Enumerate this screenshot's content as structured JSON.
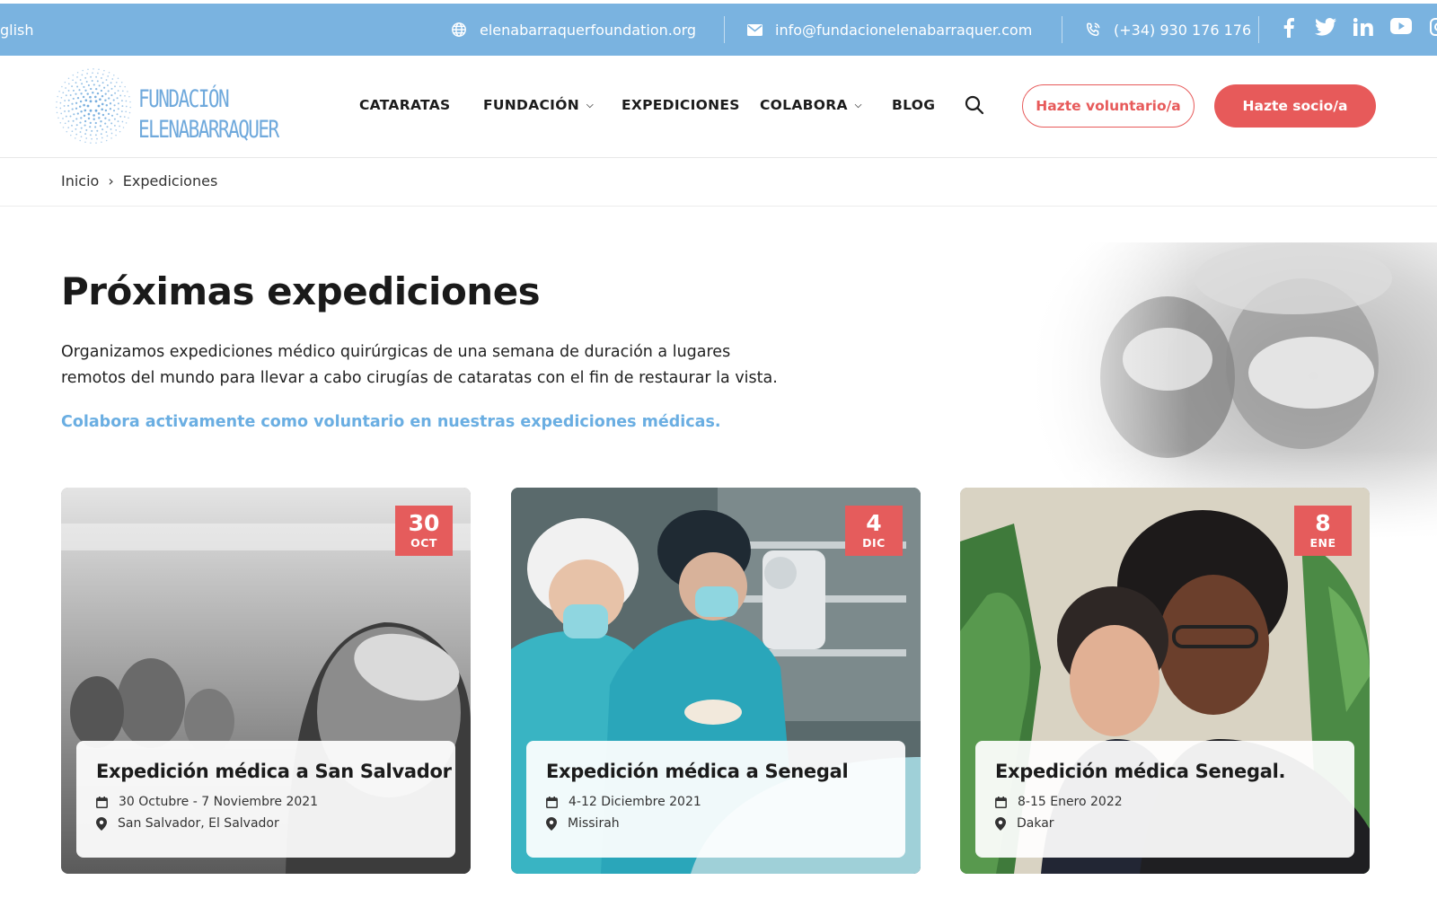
{
  "topbar": {
    "language": "glish",
    "website": "elenabarraquerfoundation.org",
    "email": "info@fundacionelenabarraquer.com",
    "phone": "(+34) 930 176 176",
    "social": [
      "facebook-icon",
      "twitter-icon",
      "linkedin-icon",
      "youtube-icon",
      "instagram-icon"
    ]
  },
  "logo": {
    "line1": "FUNDACIÓN",
    "line2": "ELENABARRAQUER"
  },
  "nav": {
    "items": [
      {
        "label": "CATARATAS",
        "dropdown": false
      },
      {
        "label": "FUNDACIÓN",
        "dropdown": true
      },
      {
        "label": "EXPEDICIONES",
        "dropdown": false
      },
      {
        "label": "COLABORA",
        "dropdown": true
      },
      {
        "label": "BLOG",
        "dropdown": false
      }
    ],
    "volunteer_button": "Hazte voluntario/a",
    "member_button": "Hazte socio/a"
  },
  "breadcrumb": {
    "home": "Inicio",
    "separator": "›",
    "current": "Expediciones"
  },
  "main": {
    "title": "Próximas expediciones",
    "intro_line1": "Organizamos expediciones médico quirúrgicas de una semana de duración a lugares",
    "intro_line2": "remotos del mundo para llevar a cabo cirugías de cataratas con el fin de restaurar la vista.",
    "cta": "Colabora activamente como voluntario en nuestras expediciones médicas."
  },
  "cards": [
    {
      "day": "30",
      "month": "OCT",
      "title": "Expedición médica a San Salvador",
      "dates": "30 Octubre - 7 Noviembre 2021",
      "location": "San Salvador, El Salvador"
    },
    {
      "day": "4",
      "month": "DIC",
      "title": "Expedición médica a Senegal",
      "dates": "4-12 Diciembre 2021",
      "location": "Missirah"
    },
    {
      "day": "8",
      "month": "ENE",
      "title": "Expedición médica Senegal.",
      "dates": "8-15 Enero 2022",
      "location": "Dakar"
    }
  ],
  "colors": {
    "topbar": "#7ab3e0",
    "accent_red": "#e75a5a",
    "link_blue": "#6aaee2",
    "logo_blue": "#6fa9dc"
  }
}
